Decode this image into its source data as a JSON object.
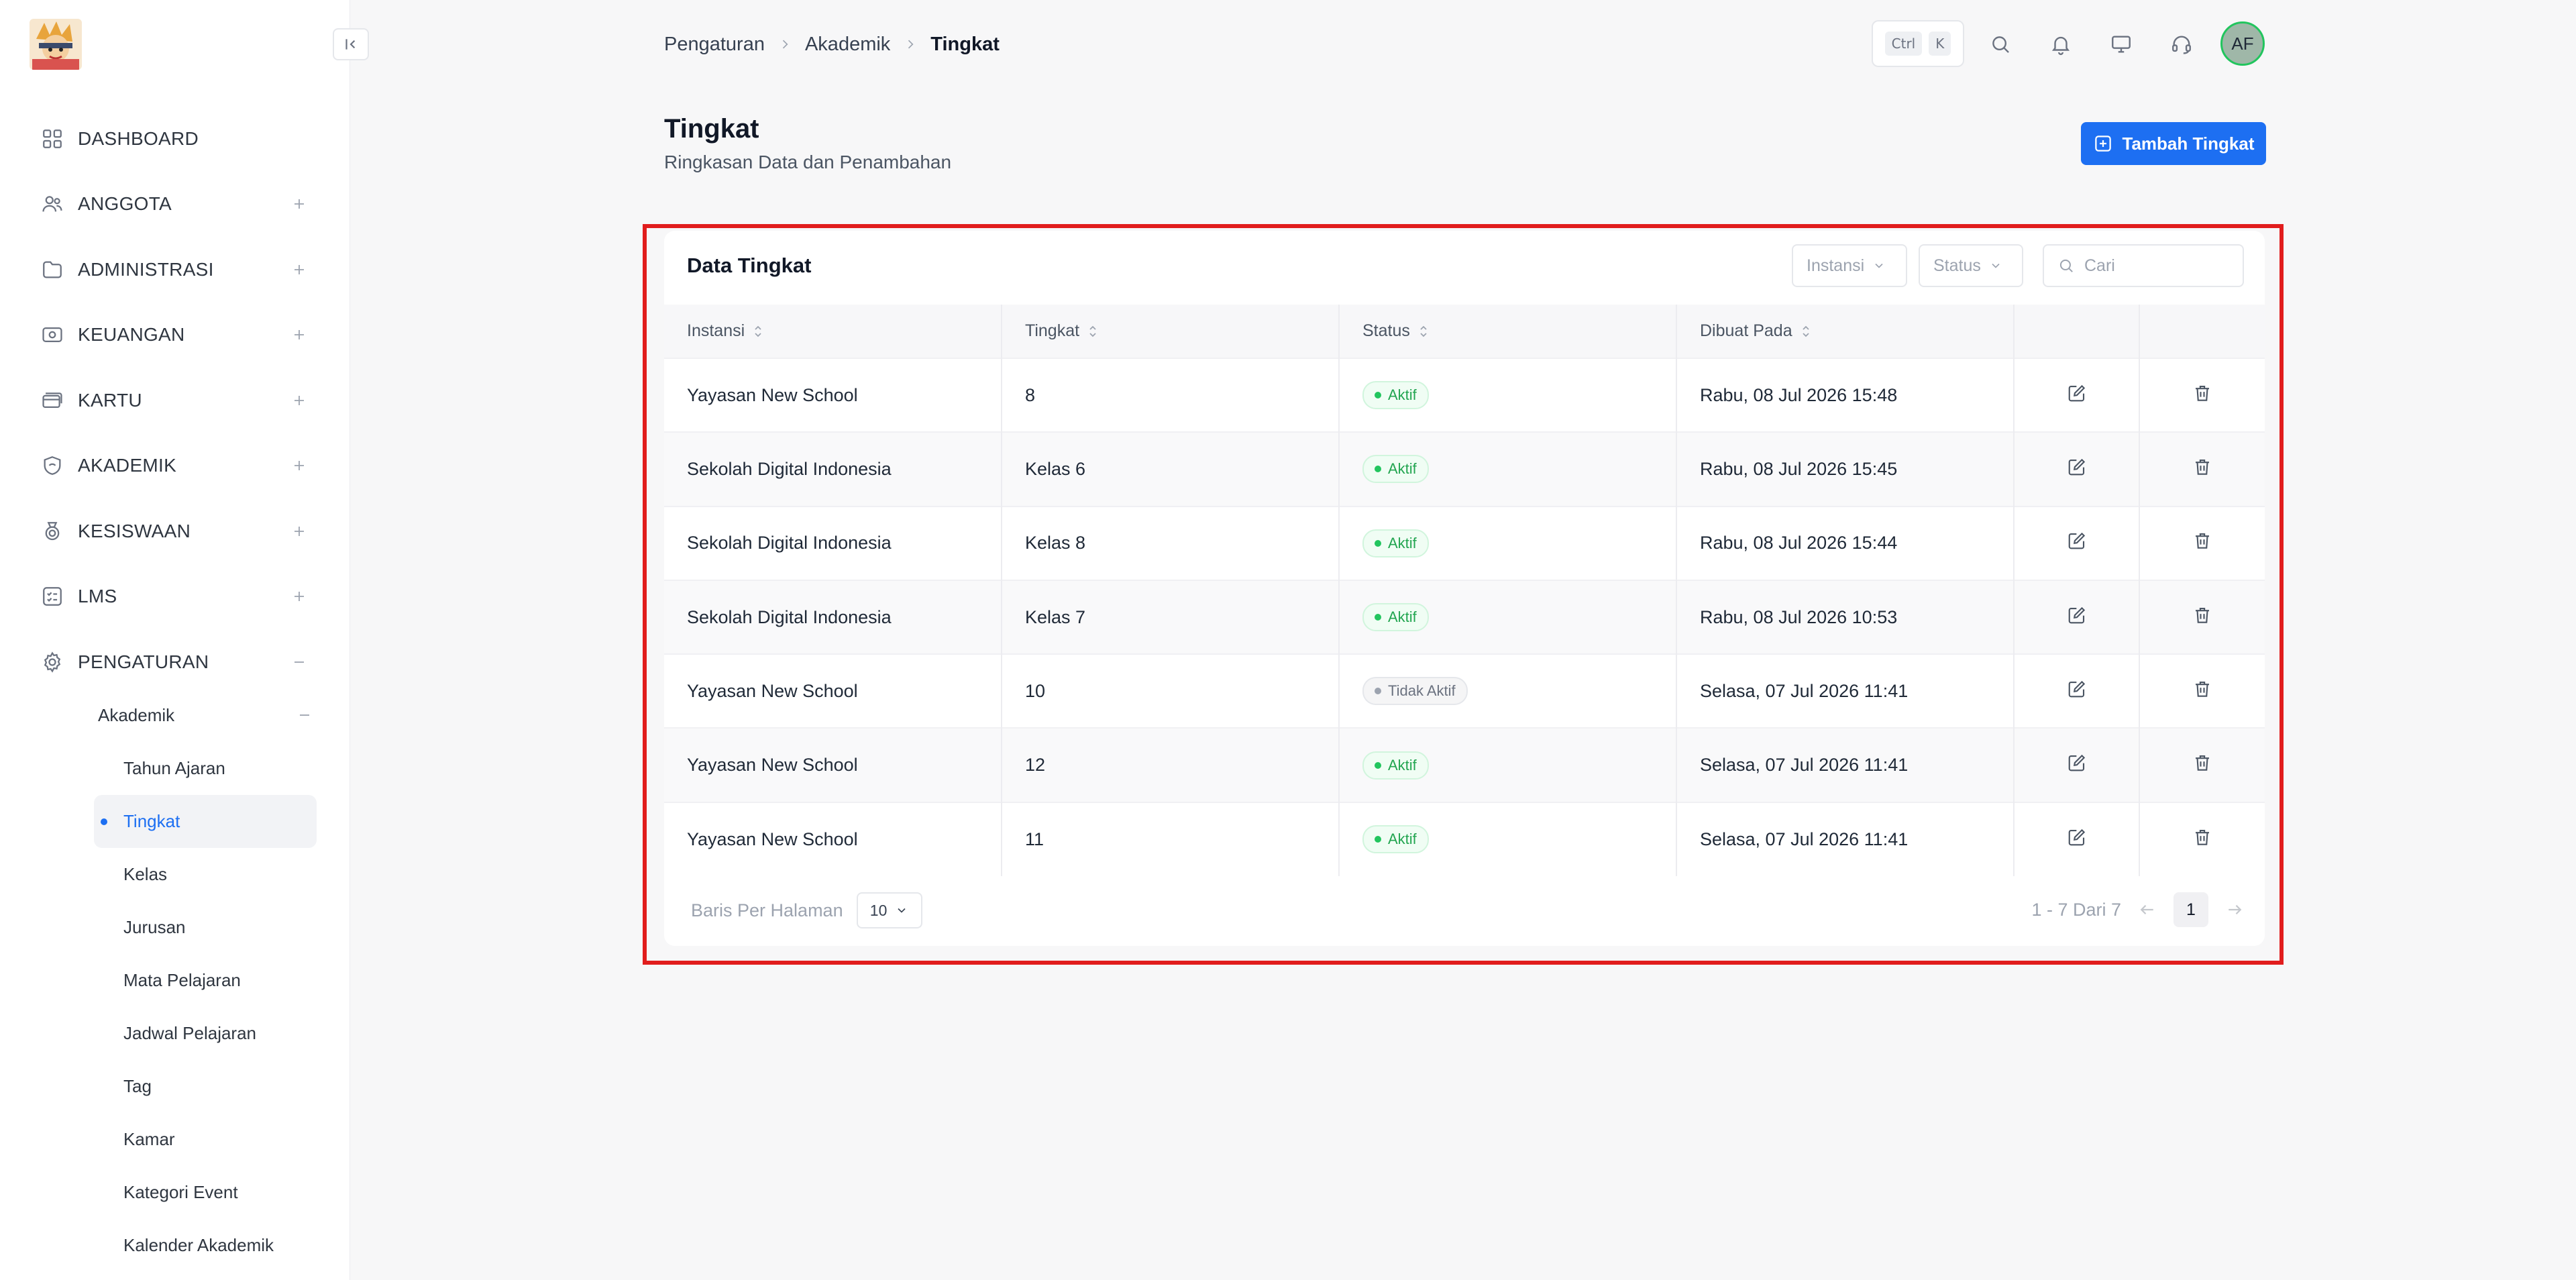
{
  "sidebar": {
    "logo": "mascot-logo",
    "items": [
      {
        "label": "DASHBOARD",
        "icon": "grid-icon",
        "expandable": false
      },
      {
        "label": "ANGGOTA",
        "icon": "users-icon",
        "expandable": true
      },
      {
        "label": "ADMINISTRASI",
        "icon": "folder-icon",
        "expandable": true
      },
      {
        "label": "KEUANGAN",
        "icon": "money-icon",
        "expandable": true
      },
      {
        "label": "KARTU",
        "icon": "card-icon",
        "expandable": true
      },
      {
        "label": "AKADEMIK",
        "icon": "shield-icon",
        "expandable": true
      },
      {
        "label": "KESISWAAN",
        "icon": "medal-icon",
        "expandable": true
      },
      {
        "label": "LMS",
        "icon": "list-icon",
        "expandable": true
      },
      {
        "label": "PENGATURAN",
        "icon": "gear-icon",
        "expandable": true,
        "expanded": true
      }
    ],
    "submenu": {
      "label": "Akademik",
      "items": [
        {
          "label": "Tahun Ajaran"
        },
        {
          "label": "Tingkat",
          "active": true
        },
        {
          "label": "Kelas"
        },
        {
          "label": "Jurusan"
        },
        {
          "label": "Mata Pelajaran"
        },
        {
          "label": "Jadwal Pelajaran"
        },
        {
          "label": "Tag"
        },
        {
          "label": "Kamar"
        },
        {
          "label": "Kategori Event"
        },
        {
          "label": "Kalender Akademik"
        }
      ]
    }
  },
  "header": {
    "breadcrumb": [
      "Pengaturan",
      "Akademik",
      "Tingkat"
    ],
    "shortcut": [
      "Ctrl",
      "K"
    ],
    "avatar_initials": "AF"
  },
  "page": {
    "title": "Tingkat",
    "subtitle": "Ringkasan Data dan Penambahan",
    "add_button": "Tambah Tingkat"
  },
  "card": {
    "title": "Data Tingkat",
    "filters": {
      "instansi": "Instansi",
      "status": "Status"
    },
    "search_placeholder": "Cari",
    "columns": [
      "Instansi",
      "Tingkat",
      "Status",
      "Dibuat Pada"
    ],
    "rows": [
      {
        "instansi": "Yayasan New School",
        "tingkat": "8",
        "status": "Aktif",
        "active": true,
        "created": "Rabu, 08 Jul 2026 15:48"
      },
      {
        "instansi": "Sekolah Digital Indonesia",
        "tingkat": "Kelas 6",
        "status": "Aktif",
        "active": true,
        "created": "Rabu, 08 Jul 2026 15:45"
      },
      {
        "instansi": "Sekolah Digital Indonesia",
        "tingkat": "Kelas 8",
        "status": "Aktif",
        "active": true,
        "created": "Rabu, 08 Jul 2026 15:44"
      },
      {
        "instansi": "Sekolah Digital Indonesia",
        "tingkat": "Kelas 7",
        "status": "Aktif",
        "active": true,
        "created": "Rabu, 08 Jul 2026 10:53"
      },
      {
        "instansi": "Yayasan New School",
        "tingkat": "10",
        "status": "Tidak Aktif",
        "active": false,
        "created": "Selasa, 07 Jul 2026 11:41"
      },
      {
        "instansi": "Yayasan New School",
        "tingkat": "12",
        "status": "Aktif",
        "active": true,
        "created": "Selasa, 07 Jul 2026 11:41"
      },
      {
        "instansi": "Yayasan New School",
        "tingkat": "11",
        "status": "Aktif",
        "active": true,
        "created": "Selasa, 07 Jul 2026 11:41"
      }
    ],
    "footer": {
      "rows_label": "Baris Per Halaman",
      "rows_value": "10",
      "range": "1 - 7 Dari 7",
      "current_page": "1"
    }
  },
  "colors": {
    "accent": "#1d6ff2",
    "active": "#22c55e",
    "highlight": "#e11d1d"
  }
}
